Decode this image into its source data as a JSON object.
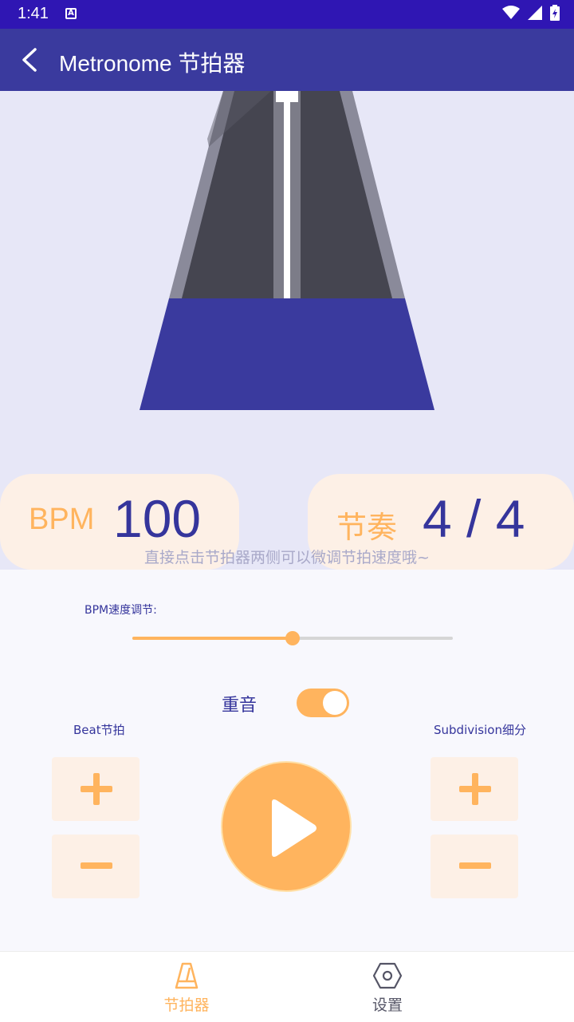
{
  "status_bar": {
    "time": "1:41",
    "notification_icon": "A"
  },
  "app_bar": {
    "title": "Metronome 节拍器",
    "back_icon": "back-arrow-icon"
  },
  "bpm_card": {
    "label": "BPM",
    "value": "100"
  },
  "rhythm_card": {
    "label": "节奏",
    "value": "4 / 4"
  },
  "hint": "直接点击节拍器两侧可以微调节拍速度哦~",
  "slider": {
    "label": "BPM速度调节:",
    "value_fraction": 0.5
  },
  "accent": {
    "label": "重音",
    "on": true
  },
  "beat": {
    "label": "Beat节拍"
  },
  "subdivision": {
    "label": "Subdivision细分"
  },
  "colors": {
    "accent": "#ffb45e",
    "primary": "#3a3a9e",
    "status": "#2f16b3"
  },
  "bottom_nav": {
    "metronome": {
      "label": "节拍器",
      "icon": "metronome-icon",
      "active": true
    },
    "settings": {
      "label": "设置",
      "icon": "hexagon-settings-icon",
      "active": false
    }
  }
}
